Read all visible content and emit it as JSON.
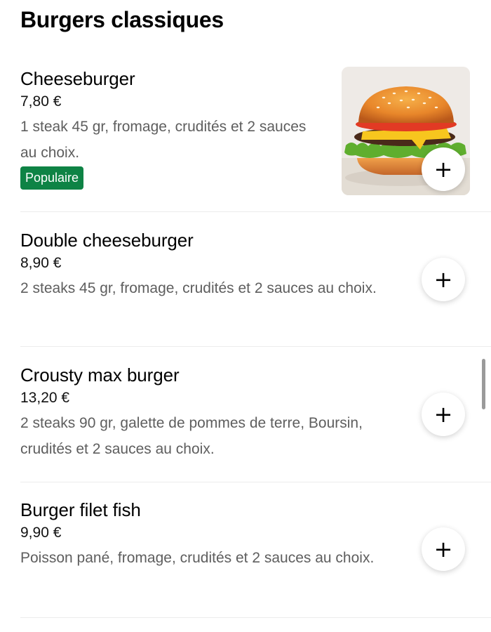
{
  "section": {
    "title": "Burgers classiques"
  },
  "items": [
    {
      "name": "Cheeseburger",
      "price": "7,80 €",
      "description": "1 steak 45 gr, fromage, crudités et 2 sauces au choix.",
      "badge": "Populaire",
      "image_icon": "burger-photo",
      "add_icon": "plus-icon"
    },
    {
      "name": "Double cheeseburger",
      "price": "8,90 €",
      "description": "2 steaks 45 gr, fromage, crudités et 2 sauces au choix.",
      "add_icon": "plus-icon"
    },
    {
      "name": "Crousty max burger",
      "price": "13,20 €",
      "description": "2 steaks 90 gr, galette de pommes de terre, Boursin, crudités et 2 sauces au choix.",
      "add_icon": "plus-icon"
    },
    {
      "name": "Burger filet fish",
      "price": "9,90 €",
      "description": "Poisson pané, fromage, crudités et 2 sauces au choix.",
      "add_icon": "plus-icon"
    }
  ],
  "add_button_symbol": "+",
  "colors": {
    "badge_background": "#0e8345",
    "description_text": "#5e5e5e",
    "divider": "#ececec"
  }
}
